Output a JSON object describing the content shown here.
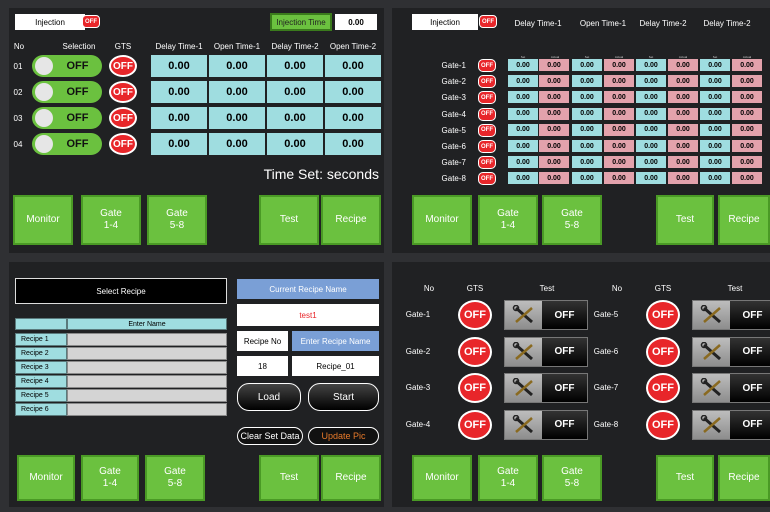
{
  "nav": {
    "monitor": "Monitor",
    "gate14_a": "Gate",
    "gate14_b": "1-4",
    "gate58_a": "Gate",
    "gate58_b": "5-8",
    "test": "Test",
    "recipe": "Recipe"
  },
  "p1": {
    "injection": "Injection",
    "off": "OFF",
    "injection_time_label": "Injection Time",
    "injection_time_value": "0.00",
    "headers": [
      "No",
      "Selection",
      "GTS",
      "Delay Time-1",
      "Open Time-1",
      "Delay Time-2",
      "Open Time-2"
    ],
    "rows": [
      {
        "no": "01",
        "sel": "OFF",
        "gts": "OFF",
        "v": [
          "0.00",
          "0.00",
          "0.00",
          "0.00"
        ]
      },
      {
        "no": "02",
        "sel": "OFF",
        "gts": "OFF",
        "v": [
          "0.00",
          "0.00",
          "0.00",
          "0.00"
        ]
      },
      {
        "no": "03",
        "sel": "OFF",
        "gts": "OFF",
        "v": [
          "0.00",
          "0.00",
          "0.00",
          "0.00"
        ]
      },
      {
        "no": "04",
        "sel": "OFF",
        "gts": "OFF",
        "v": [
          "0.00",
          "0.00",
          "0.00",
          "0.00"
        ]
      }
    ],
    "time_set": "Time Set: seconds"
  },
  "p2": {
    "injection": "Injection",
    "off": "OFF",
    "headers": [
      "Delay Time-1",
      "Open Time-1",
      "Delay Time-2",
      "Delay Time-2"
    ],
    "sub": [
      "Set",
      "Actual",
      "Set",
      "Actual",
      "Set",
      "Actual",
      "Set",
      "Actual"
    ],
    "rows": [
      {
        "gate": "Gate-1",
        "gts": "OFF",
        "v": [
          "0.00",
          "0.00",
          "0.00",
          "0.00",
          "0.00",
          "0.00",
          "0.00",
          "0.00"
        ]
      },
      {
        "gate": "Gate-2",
        "gts": "OFF",
        "v": [
          "0.00",
          "0.00",
          "0.00",
          "0.00",
          "0.00",
          "0.00",
          "0.00",
          "0.00"
        ]
      },
      {
        "gate": "Gate-3",
        "gts": "OFF",
        "v": [
          "0.00",
          "0.00",
          "0.00",
          "0.00",
          "0.00",
          "0.00",
          "0.00",
          "0.00"
        ]
      },
      {
        "gate": "Gate-4",
        "gts": "OFF",
        "v": [
          "0.00",
          "0.00",
          "0.00",
          "0.00",
          "0.00",
          "0.00",
          "0.00",
          "0.00"
        ]
      },
      {
        "gate": "Gate-5",
        "gts": "OFF",
        "v": [
          "0.00",
          "0.00",
          "0.00",
          "0.00",
          "0.00",
          "0.00",
          "0.00",
          "0.00"
        ]
      },
      {
        "gate": "Gate-6",
        "gts": "OFF",
        "v": [
          "0.00",
          "0.00",
          "0.00",
          "0.00",
          "0.00",
          "0.00",
          "0.00",
          "0.00"
        ]
      },
      {
        "gate": "Gate-7",
        "gts": "OFF",
        "v": [
          "0.00",
          "0.00",
          "0.00",
          "0.00",
          "0.00",
          "0.00",
          "0.00",
          "0.00"
        ]
      },
      {
        "gate": "Gate-8",
        "gts": "OFF",
        "v": [
          "0.00",
          "0.00",
          "0.00",
          "0.00",
          "0.00",
          "0.00",
          "0.00",
          "0.00"
        ]
      }
    ]
  },
  "p3": {
    "select_recipe": "Select Recipe",
    "enter_name_header": "Enter Name",
    "recipes": [
      "Recipe 1",
      "Recipe 2",
      "Recipe 3",
      "Recipe 4",
      "Recipe 5",
      "Recipe 6"
    ],
    "current_recipe_label": "Current Recipe Name",
    "current_recipe_value": "test1",
    "recipe_no_label": "Recipe No",
    "enter_recipe_name_label": "Enter Recipe Name",
    "recipe_no_value": "18",
    "recipe_name_value": "Recipe_01",
    "load": "Load",
    "start": "Start",
    "clear_set_data": "Clear Set Data",
    "update_pic": "Update Pic"
  },
  "p4": {
    "headers": [
      "No",
      "GTS",
      "Test",
      "No",
      "GTS",
      "Test"
    ],
    "left": [
      {
        "gate": "Gate-1",
        "gts": "OFF",
        "test": "OFF"
      },
      {
        "gate": "Gate-2",
        "gts": "OFF",
        "test": "OFF"
      },
      {
        "gate": "Gate-3",
        "gts": "OFF",
        "test": "OFF"
      },
      {
        "gate": "Gate-4",
        "gts": "OFF",
        "test": "OFF"
      }
    ],
    "right": [
      {
        "gate": "Gate-5",
        "gts": "OFF",
        "test": "OFF"
      },
      {
        "gate": "Gate-6",
        "gts": "OFF",
        "test": "OFF"
      },
      {
        "gate": "Gate-7",
        "gts": "OFF",
        "test": "OFF"
      },
      {
        "gate": "Gate-8",
        "gts": "OFF",
        "test": "OFF"
      }
    ]
  },
  "colors": {
    "green": "#6bc13f",
    "red": "#e8262a",
    "cyan": "#9fdde0",
    "pink": "#e3a2ac",
    "blue": "#7a9fd6",
    "orange": "#e87a2a"
  }
}
